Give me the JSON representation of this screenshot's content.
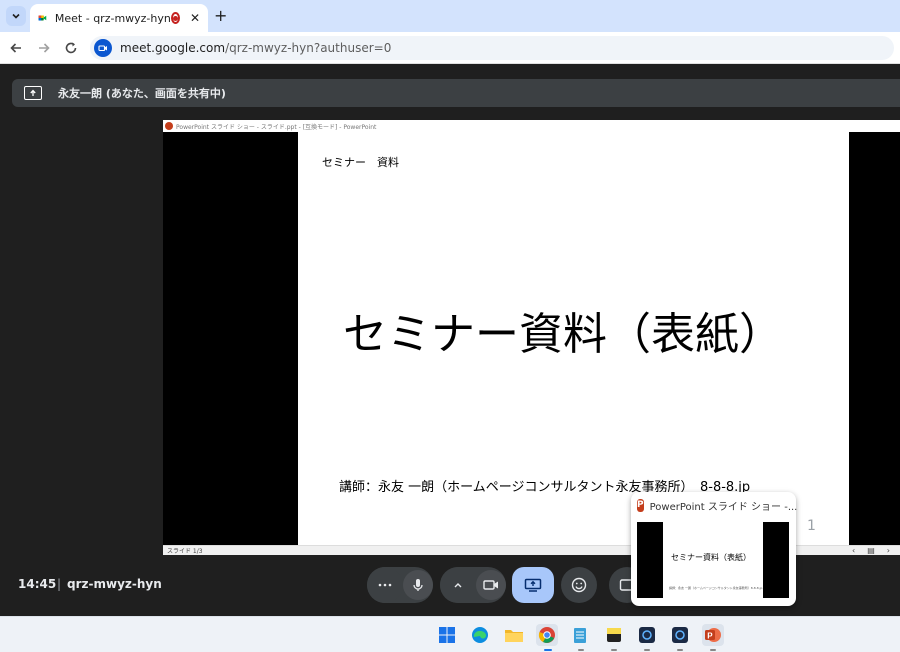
{
  "browser": {
    "tab_title": "Meet - qrz-mwyz-hyn",
    "new_tab": "+",
    "url_host": "meet.google.com",
    "url_path": "/qrz-mwyz-hyn?authuser=0"
  },
  "meet": {
    "presenting_text": "永友一朗 (あなた、画面を共有中)",
    "clock": "14:45",
    "separator": "|",
    "meeting_code": "qrz-mwyz-hyn",
    "page_count": "1"
  },
  "slide": {
    "window_title": "PowerPoint スライド ショー - スライド.ppt - [互換モード] - PowerPoint",
    "label": "セミナー　資料",
    "title": "セミナー資料（表紙）",
    "subtitle": "講師：永友 一朗（ホームページコンサルタント永友事務所）　8-8-8.jp",
    "status": "スライド 1/3"
  },
  "thumbnail": {
    "title": "PowerPoint スライド ショー -...",
    "preview_title": "セミナー資料（表紙）",
    "preview_sub": "講師：永友 一朗（ホームページコンサルタント永友事務所）8-8-8.jp"
  },
  "colors": {
    "accent": "#a8c7fa",
    "recording": "#c5221f",
    "powerpoint": "#c43e1c"
  }
}
